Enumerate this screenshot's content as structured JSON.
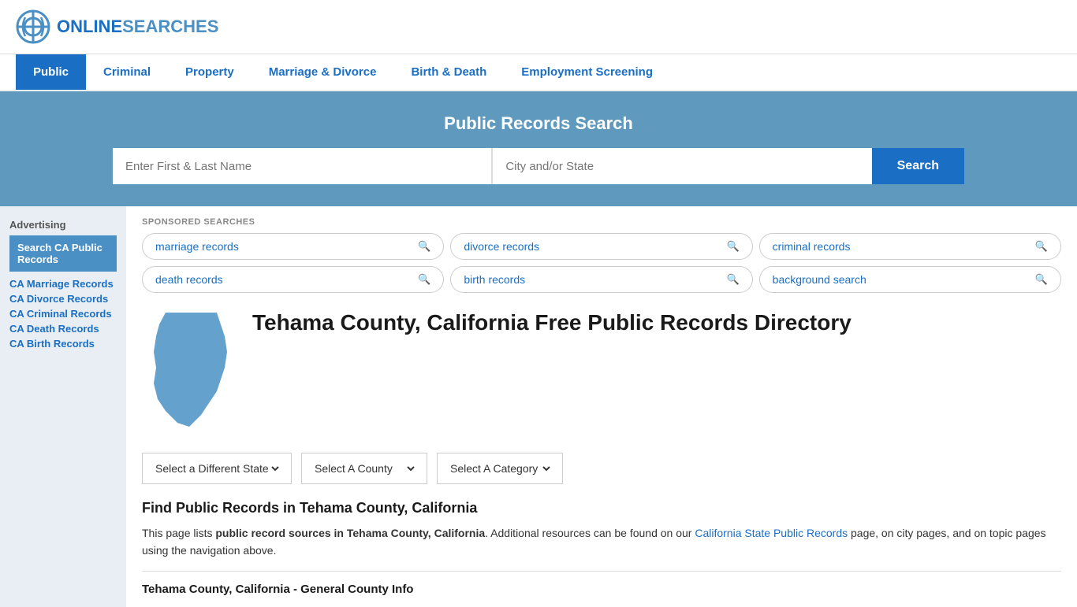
{
  "header": {
    "logo_text_normal": "ONLINE",
    "logo_text_accent": "SEARCHES"
  },
  "nav": {
    "items": [
      {
        "label": "Public",
        "active": true
      },
      {
        "label": "Criminal",
        "active": false
      },
      {
        "label": "Property",
        "active": false
      },
      {
        "label": "Marriage & Divorce",
        "active": false
      },
      {
        "label": "Birth & Death",
        "active": false
      },
      {
        "label": "Employment Screening",
        "active": false
      }
    ]
  },
  "search_hero": {
    "title": "Public Records Search",
    "name_placeholder": "Enter First & Last Name",
    "location_placeholder": "City and/or State",
    "search_button": "Search"
  },
  "sponsored": {
    "label": "SPONSORED SEARCHES",
    "tags": [
      {
        "label": "marriage records"
      },
      {
        "label": "divorce records"
      },
      {
        "label": "criminal records"
      },
      {
        "label": "death records"
      },
      {
        "label": "birth records"
      },
      {
        "label": "background search"
      }
    ]
  },
  "sidebar": {
    "advertising_label": "Advertising",
    "ad_box_text": "Search CA Public Records",
    "links": [
      "CA Marriage Records",
      "CA Divorce Records",
      "CA Criminal Records",
      "CA Death Records",
      "CA Birth Records"
    ]
  },
  "county": {
    "title": "Tehama County, California Free Public Records Directory"
  },
  "dropdowns": {
    "state_label": "Select a Different State",
    "county_label": "Select A County",
    "category_label": "Select A Category"
  },
  "find_section": {
    "title": "Find Public Records in Tehama County, California",
    "text_part1": "This page lists ",
    "text_bold": "public record sources in Tehama County, California",
    "text_part2": ". Additional resources can be found on our ",
    "link_text": "California State Public Records",
    "text_part3": " page, on city pages, and on topic pages using the navigation above."
  },
  "general_info": {
    "title": "Tehama County, California - General County Info"
  }
}
